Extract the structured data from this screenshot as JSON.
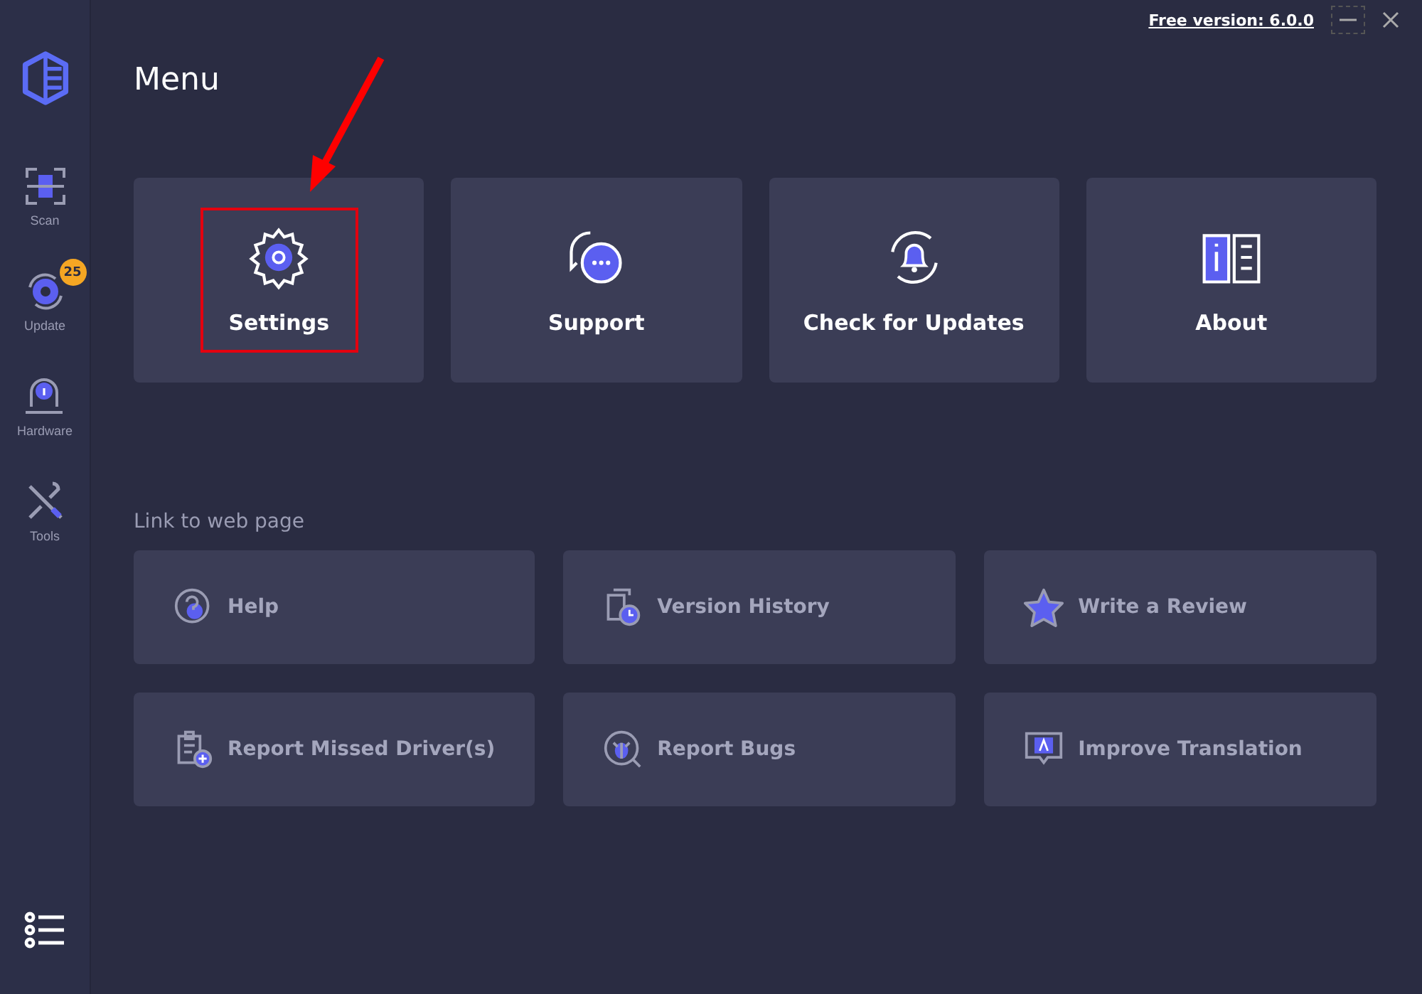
{
  "title_bar": {
    "version_link": "Free version: 6.0.0"
  },
  "sidebar": {
    "items": [
      {
        "kind": "scan",
        "label": "Scan",
        "selected": false
      },
      {
        "kind": "update",
        "label": "Update",
        "selected": false,
        "badge": "25"
      },
      {
        "kind": "hardware",
        "label": "Hardware",
        "selected": false
      },
      {
        "kind": "tools",
        "label": "Tools",
        "selected": false
      }
    ]
  },
  "heading": "Menu",
  "menu_items": [
    {
      "kind": "settings",
      "label": "Settings",
      "highlighted": true
    },
    {
      "kind": "support",
      "label": "Support",
      "highlighted": false
    },
    {
      "kind": "updates",
      "label": "Check for Updates",
      "highlighted": false
    },
    {
      "kind": "about",
      "label": "About",
      "highlighted": false
    }
  ],
  "links_heading": "Link to web page",
  "links": [
    {
      "kind": "help",
      "label": "Help"
    },
    {
      "kind": "history",
      "label": "Version History"
    },
    {
      "kind": "review",
      "label": "Write a Review"
    },
    {
      "kind": "driver",
      "label": "Report Missed Driver(s)"
    },
    {
      "kind": "bugs",
      "label": "Report Bugs"
    },
    {
      "kind": "translation",
      "label": "Improve Translation"
    }
  ]
}
